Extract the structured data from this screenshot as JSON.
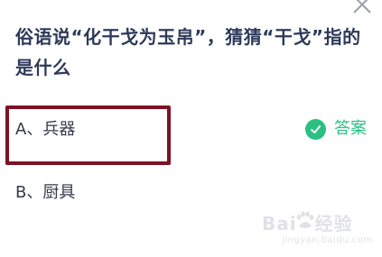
{
  "question": {
    "line1": "俗语说“化干戈为玉帛”，猜猜“干戈”指的",
    "line2": "是什么"
  },
  "options": [
    {
      "label": "A、兵器",
      "selected": true
    },
    {
      "label": "B、厨具",
      "selected": false
    }
  ],
  "answer_tag": {
    "label": "答案",
    "icon": "check-circle-icon",
    "color": "#2cbf82"
  },
  "close_icon": "close-icon",
  "highlight_color": "#7d1224",
  "watermark": {
    "main_left": "Bai",
    "main_right": "经验",
    "sub": "jingyan.baidu.com"
  }
}
